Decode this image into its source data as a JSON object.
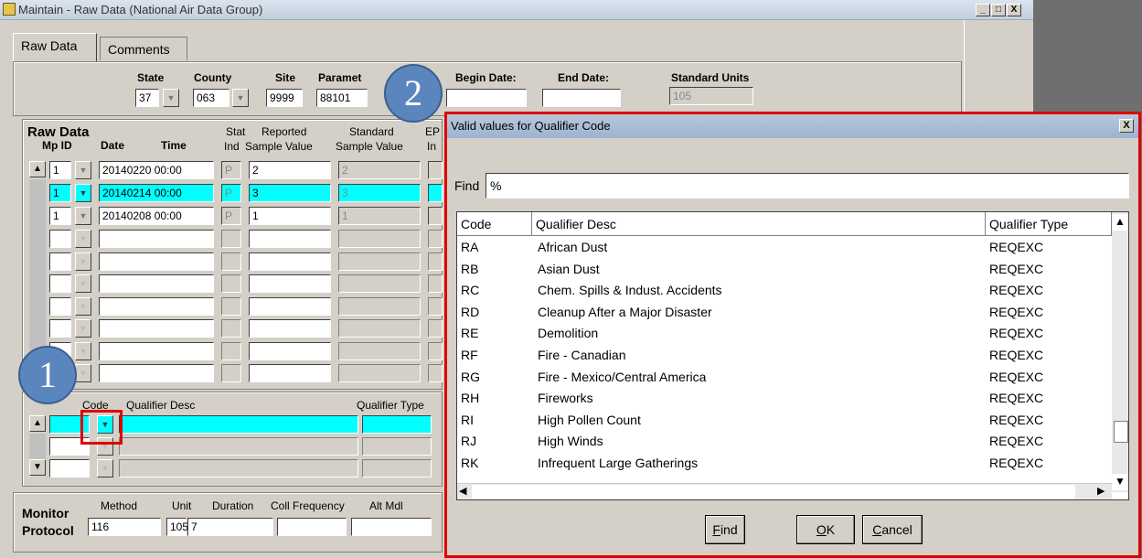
{
  "window": {
    "title": "Maintain - Raw Data (National Air Data Group)",
    "tabs": [
      "Raw Data",
      "Comments"
    ],
    "controls": {
      "minimize": "_",
      "maximize": "□",
      "close": "X"
    }
  },
  "header": {
    "state_label": "State",
    "state_value": "37",
    "county_label": "County",
    "county_value": "063",
    "site_label": "Site",
    "site_value": "9999",
    "parameter_label": "Paramet",
    "parameter_value": "88101",
    "begin_date_label": "Begin Date:",
    "begin_date_value": "",
    "end_date_label": "End Date:",
    "end_date_value": "",
    "standard_units_label": "Standard Units",
    "standard_units_value": "105"
  },
  "raw_data": {
    "title": "Raw Data",
    "headers": {
      "mp_id": "Mp ID",
      "date": "Date",
      "time": "Time",
      "stat_top": "Stat",
      "stat_bottom": "Ind",
      "reported_top": "Reported",
      "reported_bottom": "Sample Value",
      "standard_top": "Standard",
      "standard_bottom": "Sample  Value",
      "epa_top": "EP",
      "epa_bottom": "In"
    },
    "rows": [
      {
        "mp": "1",
        "datetime": "20140220 00:00",
        "stat": "P",
        "reported": "2",
        "standard": "2",
        "selected": false
      },
      {
        "mp": "1",
        "datetime": "20140214 00:00",
        "stat": "P",
        "reported": "3",
        "standard": "3",
        "selected": true
      },
      {
        "mp": "1",
        "datetime": "20140208 00:00",
        "stat": "P",
        "reported": "1",
        "standard": "1",
        "selected": false
      }
    ]
  },
  "qualifier_block": {
    "code_label": "Code",
    "desc_label": "Qualifier Desc",
    "type_label": "Qualifier Type"
  },
  "monitor_protocol": {
    "title_1": "Monitor",
    "title_2": "Protocol",
    "method_label": "Method",
    "method_value": "116",
    "unit_label": "Unit",
    "unit_value": "105",
    "duration_label": "Duration",
    "duration_value": "7",
    "coll_freq_label": "Coll Frequency",
    "coll_freq_value": "",
    "alt_mdl_label": "Alt Mdl",
    "alt_mdl_value": ""
  },
  "callouts": {
    "one": "1",
    "two": "2"
  },
  "dialog": {
    "title": "Valid values for Qualifier Code",
    "close": "X",
    "find_label": "Find",
    "find_value": "%",
    "columns": [
      "Code",
      "Qualifier Desc",
      "Qualifier Type"
    ],
    "rows": [
      {
        "code": "RA",
        "desc": "African Dust",
        "type": "REQEXC"
      },
      {
        "code": "RB",
        "desc": "Asian Dust",
        "type": "REQEXC"
      },
      {
        "code": "RC",
        "desc": "Chem. Spills & Indust. Accidents",
        "type": "REQEXC"
      },
      {
        "code": "RD",
        "desc": "Cleanup After a Major Disaster",
        "type": "REQEXC"
      },
      {
        "code": "RE",
        "desc": "Demolition",
        "type": "REQEXC"
      },
      {
        "code": "RF",
        "desc": "Fire - Canadian",
        "type": "REQEXC"
      },
      {
        "code": "RG",
        "desc": "Fire - Mexico/Central America",
        "type": "REQEXC"
      },
      {
        "code": "RH",
        "desc": "Fireworks",
        "type": "REQEXC"
      },
      {
        "code": "RI",
        "desc": "High Pollen Count",
        "type": "REQEXC"
      },
      {
        "code": "RJ",
        "desc": "High Winds",
        "type": "REQEXC"
      },
      {
        "code": "RK",
        "desc": "Infrequent Large Gatherings",
        "type": "REQEXC"
      }
    ],
    "buttons": {
      "find": "Find",
      "ok": "OK",
      "cancel": "Cancel"
    }
  },
  "colors": {
    "selected_row": "#00ffff",
    "highlight_border": "#e00000",
    "callout": "#5b86bd"
  }
}
